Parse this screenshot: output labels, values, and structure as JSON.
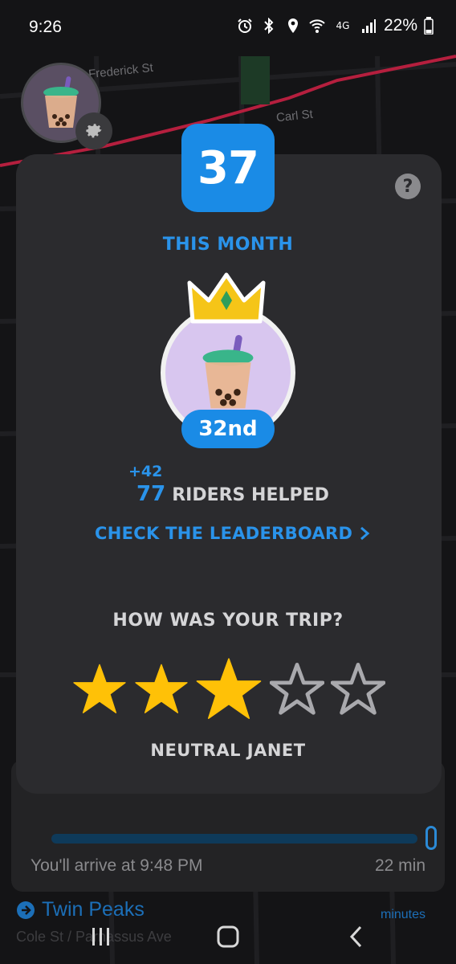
{
  "status_bar": {
    "time": "9:26",
    "battery": "22%",
    "icons": [
      "alarm-icon",
      "bluetooth-icon",
      "location-icon",
      "wifi-icon",
      "lte-icon",
      "signal-icon",
      "battery-icon"
    ],
    "network_label": "4G"
  },
  "map": {
    "streets": [
      "Frederick St",
      "Carl St"
    ],
    "route_color": "#b51f3e"
  },
  "card": {
    "count": "37",
    "period": "THIS MONTH",
    "rank": "32nd",
    "delta": "+42",
    "riders_count": "77",
    "riders_label": "RIDERS HELPED",
    "leaderboard_link": "CHECK THE LEADERBOARD",
    "trip_question": "HOW WAS YOUR TRIP?",
    "rating": 3,
    "rating_max": 5,
    "rating_label": "NEUTRAL JANET",
    "accent": "#1a8be6",
    "star_color": "#ffc107"
  },
  "trip": {
    "arrive": "You'll arrive at 9:48 PM",
    "duration": "22 min",
    "stop_name": "Twin Peaks",
    "stop_sub": "Cole St / Parnassus Ave",
    "minutes_label": "minutes"
  },
  "nav": {
    "items": [
      "recent-apps-icon",
      "home-icon",
      "back-icon"
    ]
  }
}
